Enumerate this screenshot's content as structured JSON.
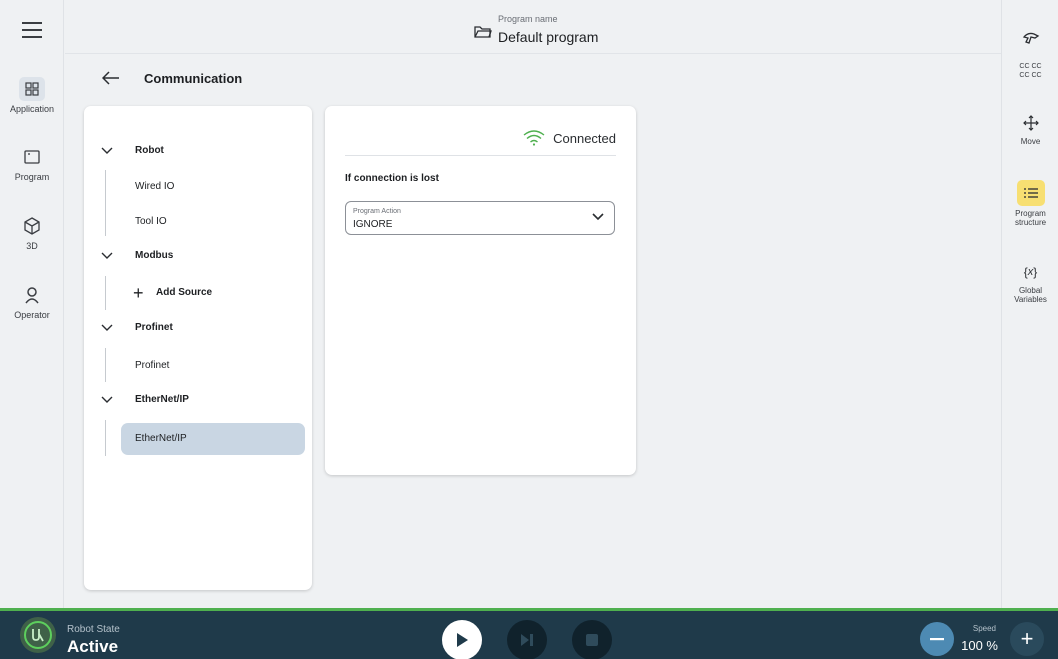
{
  "left_rail": {
    "items": [
      {
        "label": "Application",
        "icon": "grid-icon"
      },
      {
        "label": "Program",
        "icon": "window-icon"
      },
      {
        "label": "3D",
        "icon": "cube-icon"
      },
      {
        "label": "Operator",
        "icon": "person-icon"
      }
    ]
  },
  "top_bar": {
    "program_label": "Program name",
    "program_name": "Default program"
  },
  "right_rail": {
    "items": [
      {
        "label": "",
        "icon": "freedrive-icon"
      },
      {
        "label": "CC CC\nCC CC",
        "icon": "io-text-icon"
      },
      {
        "label": "Move",
        "icon": "move-arrows-icon"
      },
      {
        "label": "Program structure",
        "icon": "list-icon"
      },
      {
        "label": "Global Variables",
        "icon": "variables-icon"
      }
    ]
  },
  "page": {
    "title": "Communication"
  },
  "tree": {
    "sections": [
      {
        "label": "Robot",
        "children": [
          "Wired IO",
          "Tool IO"
        ]
      },
      {
        "label": "Modbus",
        "add_label": "Add Source"
      },
      {
        "label": "Profinet",
        "children": [
          "Profinet"
        ]
      },
      {
        "label": "EtherNet/IP",
        "children": [
          "EtherNet/IP"
        ]
      }
    ],
    "selected": "EtherNet/IP"
  },
  "detail": {
    "status": "Connected",
    "lost_label": "If connection is lost",
    "select_caption": "Program Action",
    "select_value": "IGNORE"
  },
  "bottom_bar": {
    "logo_text": "UR",
    "state_label": "Robot State",
    "state_value": "Active",
    "speed_label": "Speed",
    "speed_value": "100 %"
  },
  "colors": {
    "accent_green": "#4fb04f",
    "bottom_bar": "#1f3a4a",
    "selected_item": "#c9d6e3",
    "highlight_yellow": "#f7df72"
  }
}
